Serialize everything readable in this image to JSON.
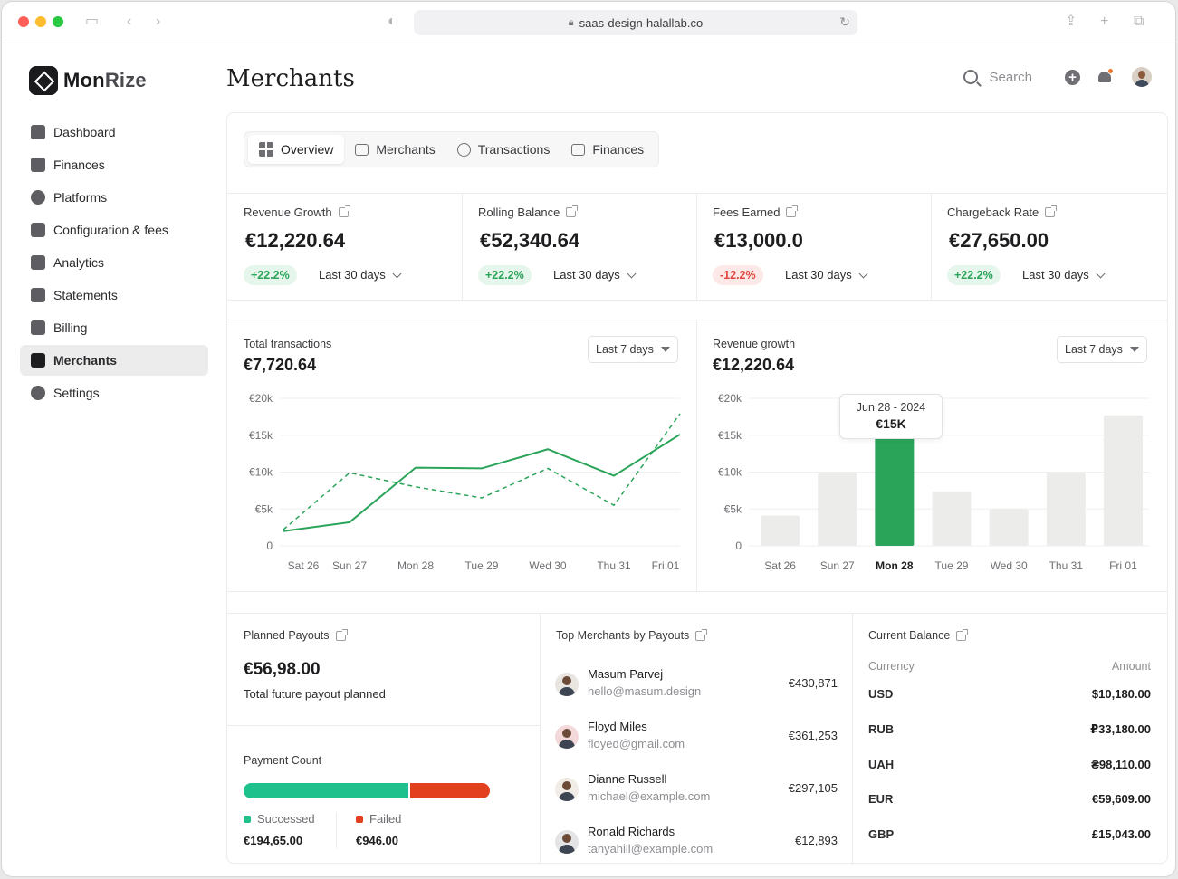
{
  "browser": {
    "url": "saas-design-halallab.co"
  },
  "brand": {
    "name_strong": "Mon",
    "name_light": "Rize"
  },
  "sidebar": {
    "items": [
      {
        "label": "Dashboard",
        "icon": "home-icon"
      },
      {
        "label": "Finances",
        "icon": "wallet-icon"
      },
      {
        "label": "Platforms",
        "icon": "globe-icon"
      },
      {
        "label": "Configuration & fees",
        "icon": "grid-icon"
      },
      {
        "label": "Analytics",
        "icon": "chart-icon"
      },
      {
        "label": "Statements",
        "icon": "document-icon"
      },
      {
        "label": "Billing",
        "icon": "receipt-icon"
      },
      {
        "label": "Merchants",
        "icon": "briefcase-icon",
        "active": true
      },
      {
        "label": "Settings",
        "icon": "gear-icon"
      }
    ]
  },
  "header": {
    "title": "Merchants",
    "search_placeholder": "Search"
  },
  "tabs": [
    {
      "label": "Overview",
      "active": true
    },
    {
      "label": "Merchants"
    },
    {
      "label": "Transactions"
    },
    {
      "label": "Finances"
    }
  ],
  "stats": [
    {
      "label": "Revenue Growth",
      "value": "€12,220.64",
      "change": "+22.2%",
      "trend": "up",
      "period": "Last 30 days"
    },
    {
      "label": "Rolling Balance",
      "value": "€52,340.64",
      "change": "+22.2%",
      "trend": "up",
      "period": "Last 30 days"
    },
    {
      "label": "Fees Earned",
      "value": "€13,000.0",
      "change": "-12.2%",
      "trend": "down",
      "period": "Last 30 days"
    },
    {
      "label": "Chargeback Rate",
      "value": "€27,650.00",
      "change": "+22.2%",
      "trend": "up",
      "period": "Last 30 days"
    }
  ],
  "transactions_chart": {
    "title": "Total transactions",
    "value": "€7,720.64",
    "period": "Last 7 days"
  },
  "revenue_chart": {
    "title": "Revenue growth",
    "value": "€12,220.64",
    "period": "Last 7 days",
    "tooltip_date": "Jun 28 - 2024",
    "tooltip_value": "€15K"
  },
  "chart_data": [
    {
      "type": "line",
      "title": "Total transactions",
      "categories": [
        "Sat 26",
        "Sun 27",
        "Mon 28",
        "Tue 29",
        "Wed 30",
        "Thu 31",
        "Fri 01"
      ],
      "yticks": [
        "0",
        "€5k",
        "€10k",
        "€15k",
        "€20k"
      ],
      "ylim": [
        0,
        20000
      ],
      "series": [
        {
          "style": "solid",
          "color": "#2aa459",
          "values": [
            2000,
            3200,
            10600,
            10500,
            13100,
            9500,
            15100
          ]
        },
        {
          "style": "dashed",
          "color": "#2aa459",
          "values": [
            2200,
            9900,
            8000,
            6500,
            10500,
            5500,
            17900
          ]
        }
      ],
      "grid": true
    },
    {
      "type": "bar",
      "title": "Revenue growth",
      "categories": [
        "Sat 26",
        "Sun 27",
        "Mon 28",
        "Tue 29",
        "Wed 30",
        "Thu 31",
        "Fri 01"
      ],
      "yticks": [
        "0",
        "€5k",
        "€10k",
        "€15k",
        "€20k"
      ],
      "ylim": [
        0,
        20000
      ],
      "values": [
        4100,
        9900,
        15000,
        7400,
        5000,
        10000,
        17700
      ],
      "highlight_index": 2,
      "highlight_color": "#2aa459",
      "bar_color": "#ececea",
      "grid": true
    }
  ],
  "planned_payouts": {
    "title": "Planned Payouts",
    "value": "€56,98.00",
    "subtitle": "Total future payout planned"
  },
  "payment_count": {
    "title": "Payment Count",
    "success_label": "Successed",
    "success_value": "€194,65.00",
    "failed_label": "Failed",
    "failed_value": "€946.00",
    "success_share": 0.67,
    "success_color": "#1ec08b",
    "failed_color": "#e2401f"
  },
  "top_merchants": {
    "title": "Top Merchants by Payouts",
    "rows": [
      {
        "name": "Masum Parvej",
        "email": "hello@masum.design",
        "amount": "€430,871"
      },
      {
        "name": "Floyd Miles",
        "email": "floyed@gmail.com",
        "amount": "€361,253"
      },
      {
        "name": "Dianne Russell",
        "email": "michael@example.com",
        "amount": "€297,105"
      },
      {
        "name": "Ronald Richards",
        "email": "tanyahill@example.com",
        "amount": "€12,893"
      }
    ]
  },
  "current_balance": {
    "title": "Current Balance",
    "col_currency": "Currency",
    "col_amount": "Amount",
    "rows": [
      {
        "currency": "USD",
        "amount": "$10,180.00"
      },
      {
        "currency": "RUB",
        "amount": "₽33,180.00"
      },
      {
        "currency": "UAH",
        "amount": "₴98,110.00"
      },
      {
        "currency": "EUR",
        "amount": "€59,609.00"
      },
      {
        "currency": "GBP",
        "amount": "£15,043.00"
      }
    ]
  }
}
